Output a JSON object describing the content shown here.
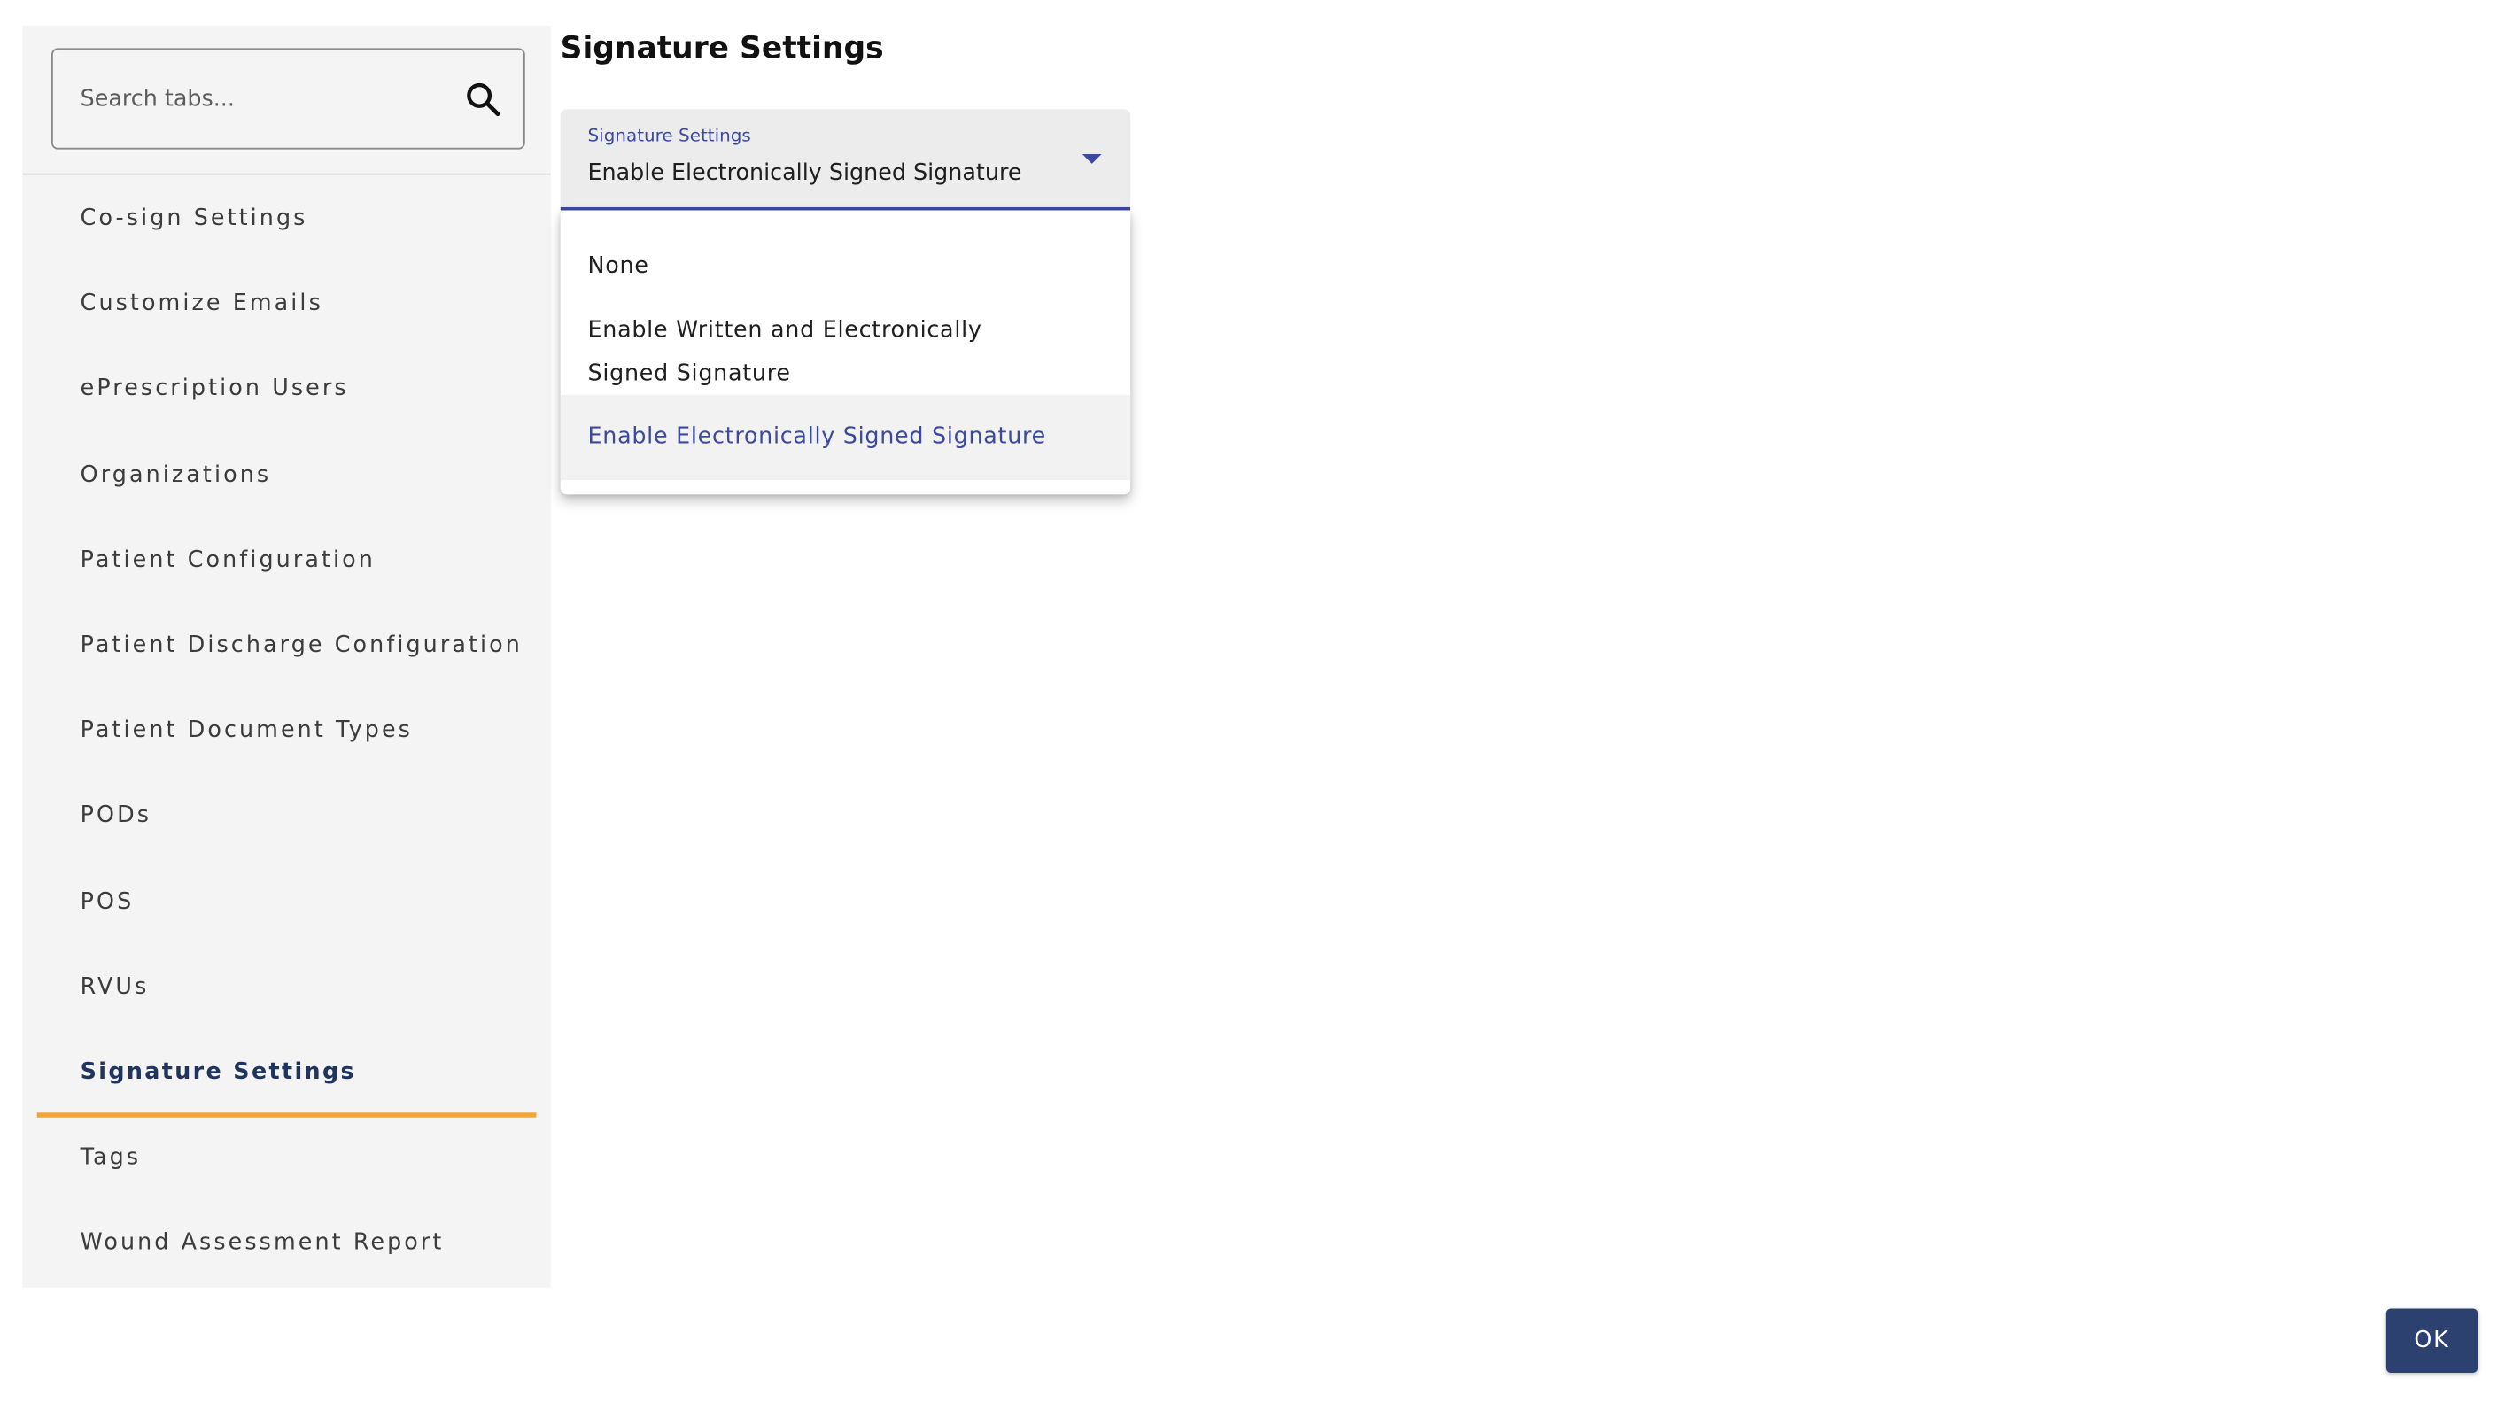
{
  "sidebar": {
    "search": {
      "placeholder": "Search tabs..."
    },
    "items": [
      {
        "label": "Co-sign Settings",
        "active": false
      },
      {
        "label": "Customize Emails",
        "active": false
      },
      {
        "label": "ePrescription Users",
        "active": false
      },
      {
        "label": "Organizations",
        "active": false
      },
      {
        "label": "Patient Configuration",
        "active": false
      },
      {
        "label": "Patient Discharge Configuration",
        "active": false
      },
      {
        "label": "Patient Document Types",
        "active": false
      },
      {
        "label": "PODs",
        "active": false
      },
      {
        "label": "POS",
        "active": false
      },
      {
        "label": "RVUs",
        "active": false
      },
      {
        "label": "Signature Settings",
        "active": true
      },
      {
        "label": "Tags",
        "active": false
      },
      {
        "label": "Wound Assessment Report",
        "active": false
      }
    ]
  },
  "main": {
    "title": "Signature Settings",
    "select": {
      "label": "Signature Settings",
      "value": "Enable Electronically Signed Signature",
      "open": true,
      "options": [
        {
          "label": "None",
          "selected": false
        },
        {
          "label": "Enable Written and Electronically Signed Signature",
          "selected": false
        },
        {
          "label": "Enable Electronically Signed Signature",
          "selected": true
        }
      ]
    }
  },
  "footer": {
    "ok_label": "OK"
  },
  "colors": {
    "accent": "#3b4aa0",
    "active_underline": "#f0a43a",
    "active_text": "#1f3560",
    "button": "#2d4170",
    "sidebar_bg": "#f4f4f4"
  },
  "icons": {
    "search": "search-icon",
    "dropdown": "chevron-down-icon"
  }
}
